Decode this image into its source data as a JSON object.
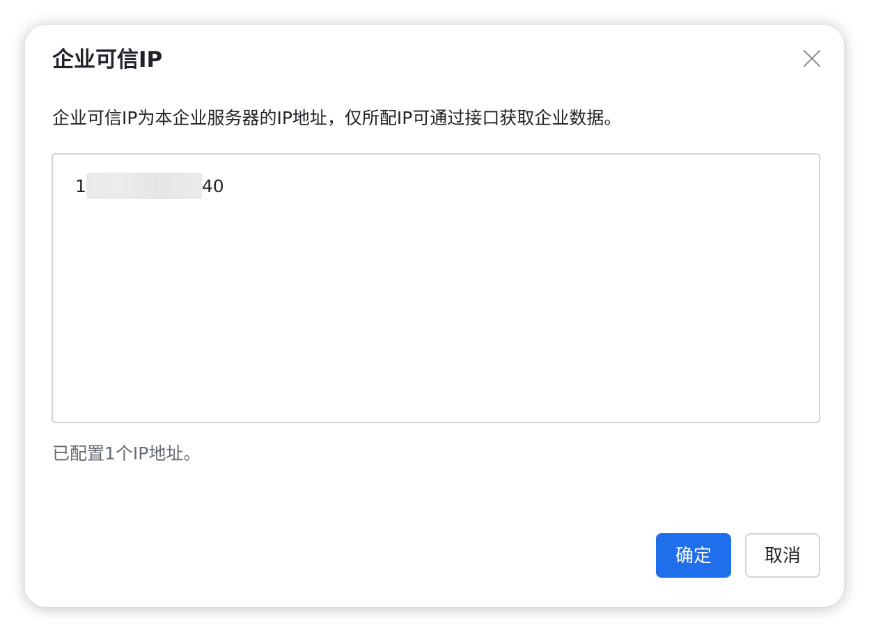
{
  "dialog": {
    "title": "企业可信IP",
    "description": "企业可信IP为本企业服务器的IP地址，仅所配IP可通过接口获取企业数据。",
    "ip_list": {
      "entries": [
        {
          "prefix": "1",
          "suffix": "40"
        }
      ]
    },
    "count_text": "已配置1个IP地址。",
    "confirm_label": "确定",
    "cancel_label": "取消",
    "close_icon": "close-icon"
  },
  "colors": {
    "primary": "#1f6eeb",
    "text": "#1f2329",
    "muted_text": "#646a73",
    "border": "#d0d3d6"
  }
}
